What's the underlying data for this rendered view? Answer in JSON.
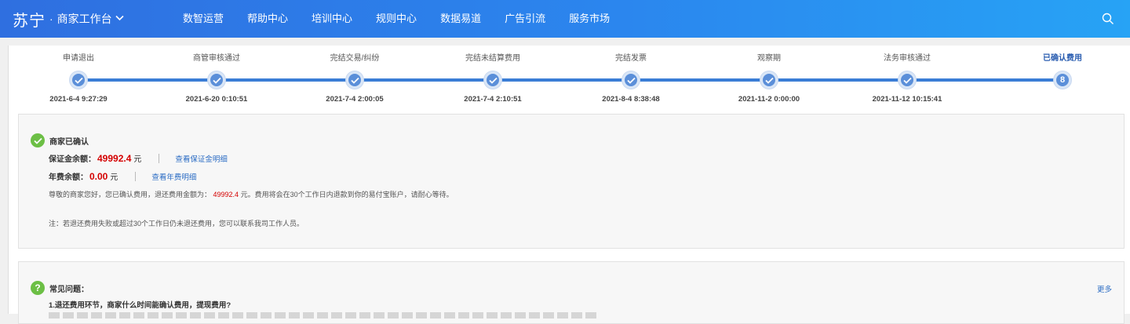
{
  "header": {
    "logo_main": "苏宁",
    "logo_dot": "·",
    "logo_sub": "商家工作台",
    "nav": [
      {
        "label": "数智运营"
      },
      {
        "label": "帮助中心"
      },
      {
        "label": "培训中心"
      },
      {
        "label": "规则中心"
      },
      {
        "label": "数据易道"
      },
      {
        "label": "广告引流"
      },
      {
        "label": "服务市场"
      }
    ],
    "icon": "search-icon"
  },
  "timeline": {
    "current_step_number": "8",
    "steps": [
      {
        "label": "申请退出",
        "date": "2021-6-4 9:27:29",
        "status": "done"
      },
      {
        "label": "商管审核通过",
        "date": "2021-6-20 0:10:51",
        "status": "done"
      },
      {
        "label": "完结交易/纠纷",
        "date": "2021-7-4 2:00:05",
        "status": "done"
      },
      {
        "label": "完结未结算费用",
        "date": "2021-7-4 2:10:51",
        "status": "done"
      },
      {
        "label": "完结发票",
        "date": "2021-8-4 8:38:48",
        "status": "done"
      },
      {
        "label": "观察期",
        "date": "2021-11-2 0:00:00",
        "status": "done"
      },
      {
        "label": "法务审核通过",
        "date": "2021-11-12 10:15:41",
        "status": "done"
      },
      {
        "label": "已确认费用",
        "date": "",
        "status": "current"
      }
    ]
  },
  "confirm": {
    "status": "商家已确认",
    "deposit_label": "保证金余额：",
    "deposit_value": "49992.4",
    "deposit_unit": "元",
    "deposit_link": "查看保证金明细",
    "annual_label": "年费余额：",
    "annual_value": "0.00",
    "annual_unit": "元",
    "annual_link": "查看年费明细",
    "notice_pre": "尊敬的商家您好，您已确认费用，退还费用金额为：",
    "notice_amount": "49992.4",
    "notice_post": "元。费用将会在30个工作日内退款到你的易付宝账户，请耐心等待。",
    "note": "注：若退还费用失败或超过30个工作日仍未退还费用，您可以联系我司工作人员。"
  },
  "faq": {
    "title": "常见问题：",
    "more": "更多",
    "question": "1.退还费用环节，商家什么时间能确认费用，提现费用?"
  },
  "colors": {
    "header_start": "#2f6fe0",
    "header_end": "#27a3f5",
    "accent": "#3a7dd6",
    "amount_red": "#d40000",
    "success_green": "#6cbf45"
  }
}
